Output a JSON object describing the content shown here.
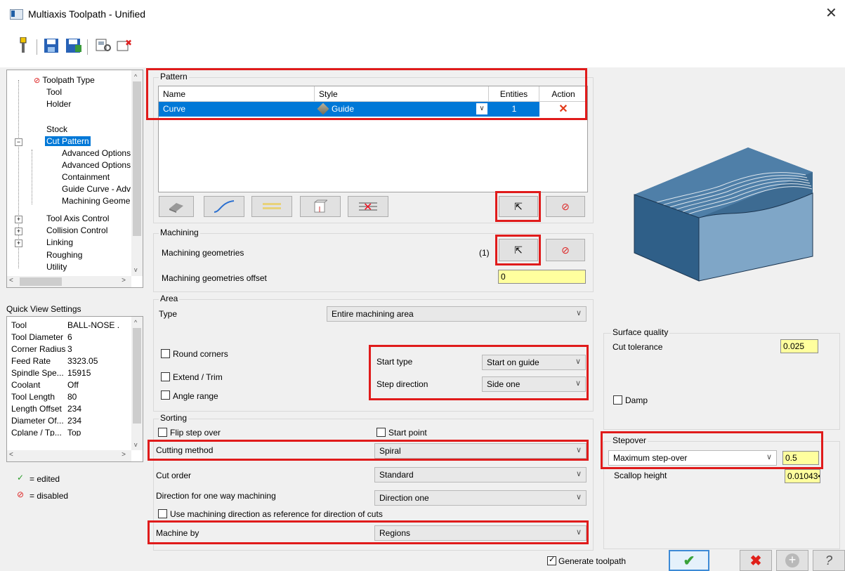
{
  "window": {
    "title": "Multiaxis Toolpath - Unified"
  },
  "tree": {
    "items": [
      {
        "label": "Toolpath Type",
        "level": 1
      },
      {
        "label": "Tool",
        "level": 1
      },
      {
        "label": "Holder",
        "level": 1
      },
      {
        "label": "",
        "level": 1
      },
      {
        "label": "Stock",
        "level": 1
      },
      {
        "label": "Cut Pattern",
        "level": 1,
        "selected": true
      },
      {
        "label": "Advanced Options",
        "level": 2
      },
      {
        "label": "Advanced Options",
        "level": 2
      },
      {
        "label": "Containment",
        "level": 2
      },
      {
        "label": "Guide Curve - Adv",
        "level": 2
      },
      {
        "label": "Machining Geome",
        "level": 2
      },
      {
        "label": "Tool Axis Control",
        "level": 1
      },
      {
        "label": "Collision Control",
        "level": 1
      },
      {
        "label": "Linking",
        "level": 1
      },
      {
        "label": "Roughing",
        "level": 1
      },
      {
        "label": "Utility",
        "level": 1
      }
    ]
  },
  "quick_view": {
    "title": "Quick View Settings",
    "rows": [
      {
        "key": "Tool",
        "value": "BALL-NOSE ."
      },
      {
        "key": "Tool Diameter",
        "value": "6"
      },
      {
        "key": "Corner Radius",
        "value": "3"
      },
      {
        "key": "Feed Rate",
        "value": "3323.05"
      },
      {
        "key": "Spindle Spe...",
        "value": "15915"
      },
      {
        "key": "Coolant",
        "value": "Off"
      },
      {
        "key": "Tool Length",
        "value": "80"
      },
      {
        "key": "Length Offset",
        "value": "234"
      },
      {
        "key": "Diameter Of...",
        "value": "234"
      },
      {
        "key": "Cplane / Tp...",
        "value": "Top"
      }
    ]
  },
  "legend": {
    "edited": "= edited",
    "disabled": "= disabled"
  },
  "pattern": {
    "group_label": "Pattern",
    "columns": [
      "Name",
      "Style",
      "Entities",
      "Action"
    ],
    "row": {
      "name": "Curve",
      "style": "Guide",
      "entities": "1"
    }
  },
  "machining": {
    "group_label": "Machining",
    "geometries_label": "Machining geometries",
    "geometries_count": "(1)",
    "offset_label": "Machining geometries offset",
    "offset_value": "0"
  },
  "area": {
    "group_label": "Area",
    "type_label": "Type",
    "type_value": "Entire machining area",
    "round_corners": "Round corners",
    "extend_trim": "Extend / Trim",
    "angle_range": "Angle range",
    "start_type_label": "Start type",
    "start_type_value": "Start on guide",
    "step_direction_label": "Step direction",
    "step_direction_value": "Side one"
  },
  "sorting": {
    "group_label": "Sorting",
    "flip_step_over": "Flip step over",
    "start_point": "Start point",
    "cutting_method_label": "Cutting method",
    "cutting_method_value": "Spiral",
    "cut_order_label": "Cut order",
    "cut_order_value": "Standard",
    "direction_label": "Direction for one way machining",
    "direction_value": "Direction one",
    "use_machining_dir": "Use machining direction as reference for direction of cuts",
    "machine_by_label": "Machine by",
    "machine_by_value": "Regions"
  },
  "surface_quality": {
    "group_label": "Surface quality",
    "cut_tolerance_label": "Cut tolerance",
    "cut_tolerance_value": "0.025",
    "damp": "Damp"
  },
  "stepover": {
    "group_label": "Stepover",
    "mode_value": "Maximum step-over",
    "mode_input": "0.5",
    "scallop_label": "Scallop height",
    "scallop_value": "0.01043•"
  },
  "footer": {
    "generate_toolpath": "Generate toolpath"
  }
}
